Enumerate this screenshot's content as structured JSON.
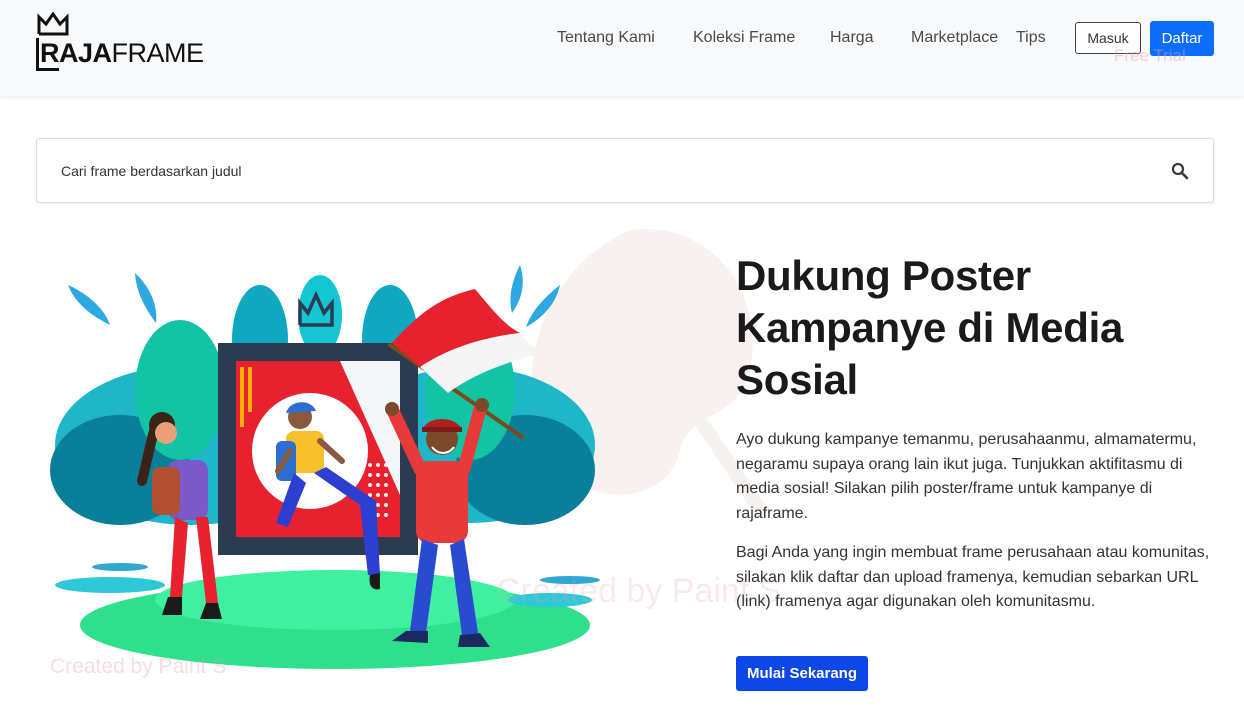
{
  "brand": {
    "logo_bold1": "R",
    "logo_bold2": "AJA",
    "logo_rest": "FRAME"
  },
  "nav": {
    "items": [
      {
        "label": "Tentang Kami"
      },
      {
        "label": "Koleksi Frame"
      },
      {
        "label": "Harga"
      },
      {
        "label": "Marketplace"
      },
      {
        "label": "Tips"
      }
    ],
    "login_label": "Masuk",
    "register_label": "Daftar"
  },
  "search": {
    "placeholder": "Cari frame berdasarkan judul"
  },
  "hero": {
    "title": "Dukung Poster Kampanye di Media Sosial",
    "paragraph1": "Ayo dukung kampanye temanmu, perusahaanmu, almamatermu, negaramu supaya orang lain ikut juga. Tunjukkan aktifitasmu di media sosial! Silakan pilih poster/frame untuk kampanye di rajaframe.",
    "paragraph2": "Bagi Anda yang ingin membuat frame perusahaan atau komunitas, silakan klik daftar dan upload framenya, kemudian sebarkan URL (link) framenya agar digunakan oleh komunitasmu.",
    "cta_label": "Mulai Sekarang"
  },
  "watermarks": {
    "nav_watermark": "Free Trial",
    "mid_watermark": "Created by Paint S",
    "bottom_watermark": "Created by Paint S"
  },
  "colors": {
    "primary": "#0d6efd",
    "cta": "#0d47e8",
    "navbar_bg": "#f8f9fa",
    "flag_red": "#e8212e",
    "leaf_teal": "#2fb8c6"
  },
  "icons": {
    "search": "search-icon",
    "crown": "crown-icon"
  }
}
